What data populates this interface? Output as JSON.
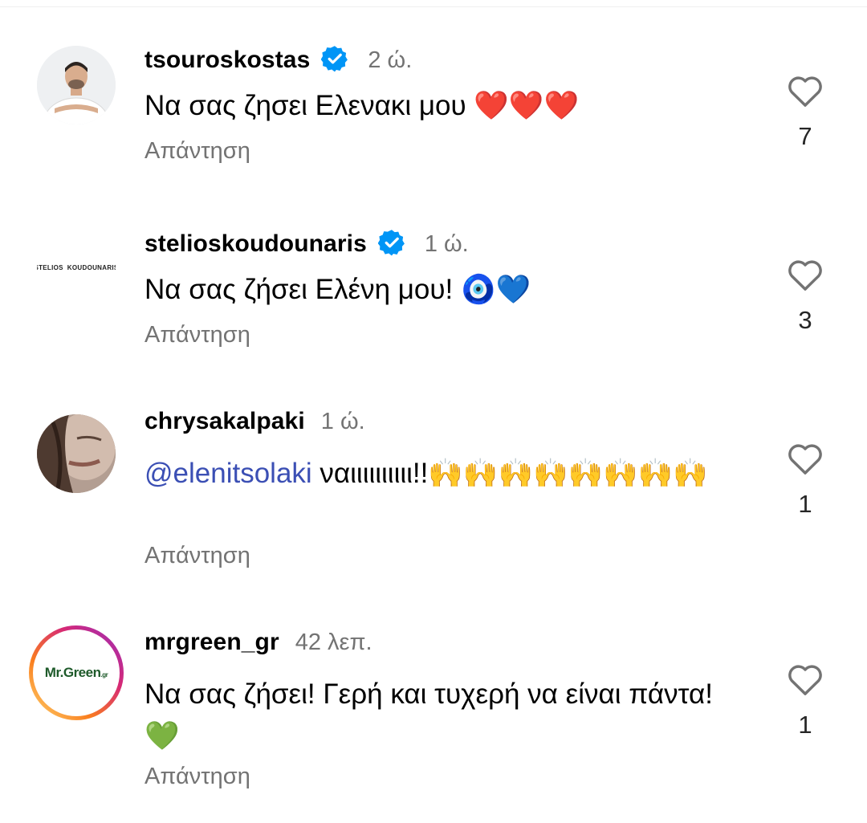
{
  "reply_label": "Απάντηση",
  "comments": [
    {
      "username": "tsouroskostas",
      "verified": true,
      "time": "2 ώ.",
      "text": "Να σας ζησει Ελενακι μου ❤️❤️❤️",
      "likes": "7"
    },
    {
      "username": "stelioskoudounaris",
      "verified": true,
      "time": "1 ώ.",
      "text": "Να σας ζήσει Ελένη μου! 🧿💙",
      "avatar_text": "STELIOS KOUDOUNARIS",
      "likes": "3"
    },
    {
      "username": "chrysakalpaki",
      "verified": false,
      "time": "1 ώ.",
      "mention": "@elenitsolaki",
      "text": " ναιιιιιιιιιι!!🙌🙌🙌🙌🙌🙌🙌🙌",
      "likes": "1"
    },
    {
      "username": "mrgreen_gr",
      "verified": false,
      "time": "42 λεπ.",
      "text": "Να σας ζήσει! Γερή και τυχερή να είναι πάντα! 💚",
      "avatar_text": "Mr.Green.gr",
      "likes": "1"
    }
  ],
  "colors": {
    "username": "#000000",
    "secondary": "#737373",
    "mention": "#3b4fb4",
    "verified": "#0095f6"
  },
  "icons": [
    "verified-badge-icon",
    "heart-outline-icon"
  ]
}
